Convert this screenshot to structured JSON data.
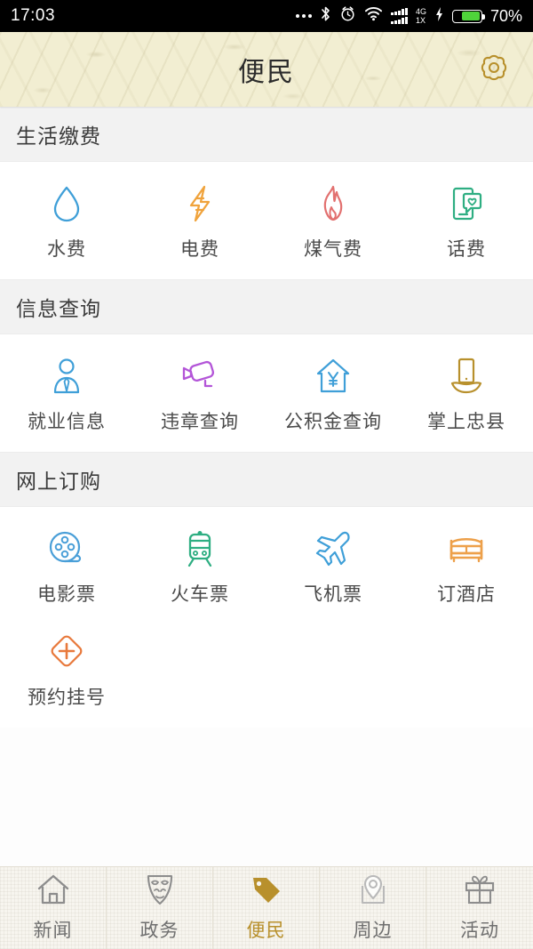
{
  "status_bar": {
    "time": "17:03",
    "battery_percent": "70%",
    "network_primary": "4G",
    "network_secondary": "1X",
    "icons": [
      "more-dots-icon",
      "bluetooth-icon",
      "alarm-clock-icon",
      "wifi-icon",
      "signal-bars-icon",
      "charging-bolt-icon",
      "battery-icon"
    ]
  },
  "header": {
    "title": "便民",
    "settings_icon": "gear-icon",
    "background_color": "#f2eed2",
    "accent_color": "#b8902c"
  },
  "sections": [
    {
      "title": "生活缴费",
      "items": [
        {
          "label": "水费",
          "icon": "water-drop-icon",
          "color": "#3f9fd8"
        },
        {
          "label": "电费",
          "icon": "lightning-bolt-icon",
          "color": "#f0a33c"
        },
        {
          "label": "煤气费",
          "icon": "flame-icon",
          "color": "#e2706f"
        },
        {
          "label": "话费",
          "icon": "phone-message-heart-icon",
          "color": "#2eae82"
        }
      ]
    },
    {
      "title": "信息查询",
      "items": [
        {
          "label": "就业信息",
          "icon": "person-tie-icon",
          "color": "#3f9fd8"
        },
        {
          "label": "违章查询",
          "icon": "surveillance-camera-icon",
          "color": "#b355d8"
        },
        {
          "label": "公积金查询",
          "icon": "house-yuan-icon",
          "color": "#3f9fd8"
        },
        {
          "label": "掌上忠县",
          "icon": "phone-in-hand-icon",
          "color": "#b8902c"
        }
      ]
    },
    {
      "title": "网上订购",
      "items": [
        {
          "label": "电影票",
          "icon": "film-reel-icon",
          "color": "#4a9fd8"
        },
        {
          "label": "火车票",
          "icon": "train-icon",
          "color": "#2eae82"
        },
        {
          "label": "飞机票",
          "icon": "airplane-icon",
          "color": "#3f9fd8"
        },
        {
          "label": "订酒店",
          "icon": "bed-icon",
          "color": "#eda04a"
        },
        {
          "label": "预约挂号",
          "icon": "medical-cross-diamond-icon",
          "color": "#e8793c"
        }
      ]
    }
  ],
  "tabbar": {
    "active_index": 2,
    "items": [
      {
        "label": "新闻",
        "icon": "home-icon"
      },
      {
        "label": "政务",
        "icon": "opera-mask-shield-icon"
      },
      {
        "label": "便民",
        "icon": "price-tag-icon"
      },
      {
        "label": "周边",
        "icon": "map-pin-icon"
      },
      {
        "label": "活动",
        "icon": "gift-box-icon"
      }
    ]
  }
}
